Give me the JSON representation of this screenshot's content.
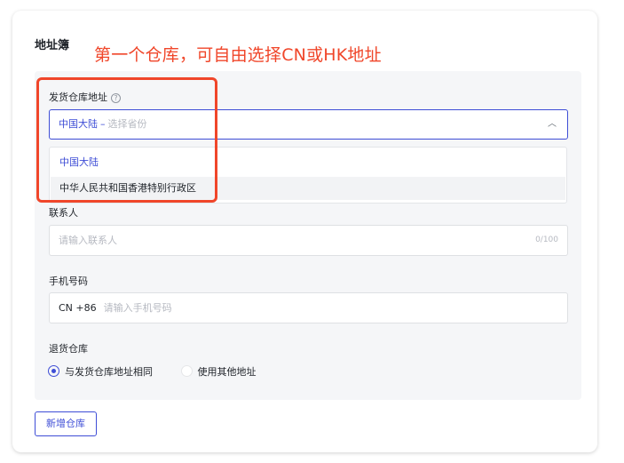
{
  "card": {
    "title": "地址簿"
  },
  "annotation": {
    "text": "第一个仓库，可自由选择CN或HK地址",
    "color": "#f0462a"
  },
  "shipping_address": {
    "label": "发货仓库地址",
    "help_icon": "question-circle-icon",
    "selected_region": "中国大陆",
    "separator": "–",
    "province_placeholder": "选择省份",
    "options": [
      "中国大陆",
      "中华人民共和国香港特别行政区"
    ]
  },
  "contact": {
    "label": "联系人",
    "placeholder": "请输入联系人",
    "counter": "0/100"
  },
  "phone": {
    "label": "手机号码",
    "prefix": "CN +86",
    "placeholder": "请输入手机号码"
  },
  "return_warehouse": {
    "label": "退货仓库",
    "options": [
      {
        "label": "与发货仓库地址相同",
        "selected": true
      },
      {
        "label": "使用其他地址",
        "selected": false
      }
    ]
  },
  "add_button": {
    "label": "新增仓库"
  },
  "colors": {
    "accent": "#3e4dd6",
    "annotation": "#f0462a"
  }
}
